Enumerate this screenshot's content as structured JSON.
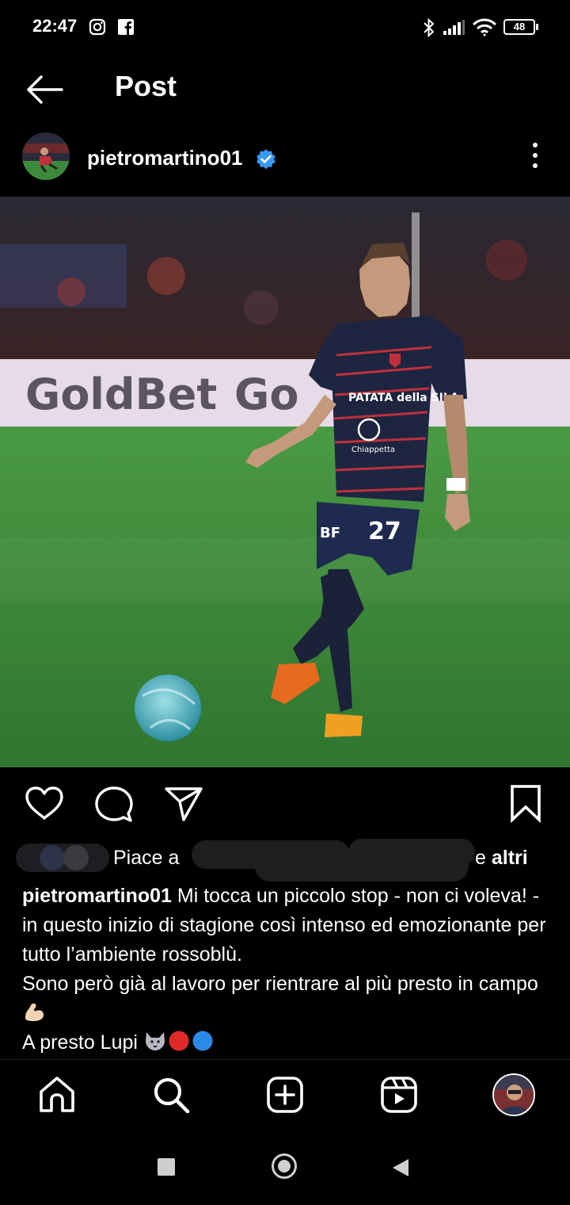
{
  "status_bar": {
    "time": "22:47",
    "battery": "48",
    "icons": [
      "instagram-icon",
      "facebook-icon",
      "bluetooth-icon",
      "signal-icon",
      "wifi-icon",
      "battery-icon"
    ]
  },
  "header": {
    "title": "Post",
    "back_icon": "arrow-left-icon"
  },
  "post": {
    "username": "pietromartino01",
    "verified": true,
    "likes": {
      "prefix": "Piace a",
      "connector": " e ",
      "others": "altri"
    },
    "caption": {
      "username": "pietromartino01",
      "line1": "Mi tocca un piccolo stop - non ci voleva! - in questo inizio di stagione così intenso ed emozionante per tutto l’ambiente rossoblù.",
      "line2": "Sono però già al lavoro per rientrare al più presto in campo",
      "line3": "A presto Lupi"
    },
    "photo": {
      "banner_text_left": "GoldBet",
      "banner_text_right": "Go",
      "jersey_sponsor": "PATATA della SILA",
      "jersey_sponsor2": "Chiappetta",
      "shirt_number": "27",
      "shorts_text": "BF"
    }
  },
  "actions": [
    "heart-icon",
    "comment-icon",
    "share-icon",
    "bookmark-icon"
  ],
  "bottom_nav": [
    "home-icon",
    "search-icon",
    "create-icon",
    "reels-icon",
    "profile-avatar"
  ],
  "system_nav": [
    "recents-icon",
    "home-circle-icon",
    "back-triangle-icon"
  ],
  "colors": {
    "background": "#000000",
    "verified_blue": "#3897f0",
    "pitch_green": "#3f8a3a",
    "jersey_navy": "#1d2540",
    "jersey_red": "#c0303a"
  }
}
